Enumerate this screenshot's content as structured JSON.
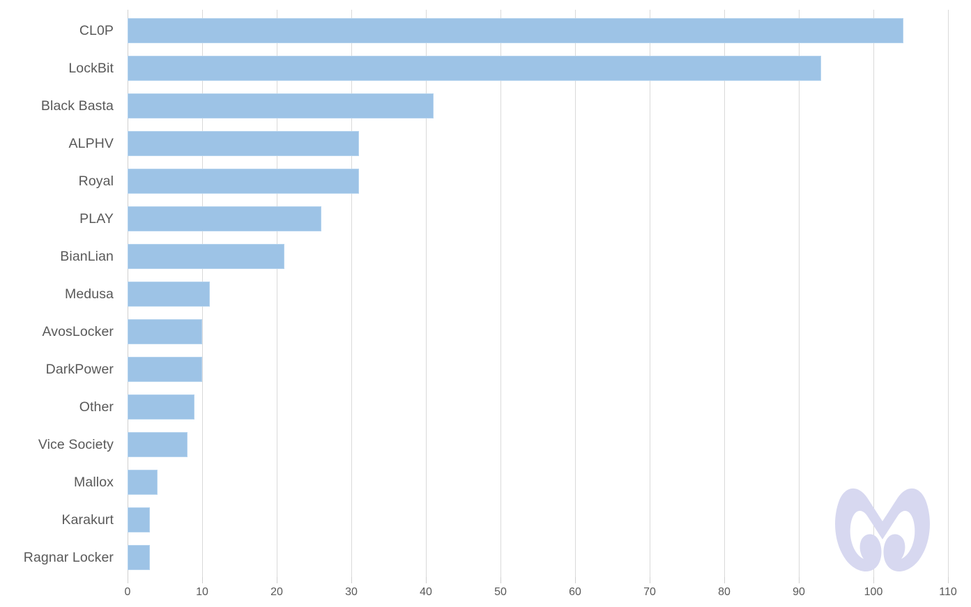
{
  "chart_data": {
    "type": "bar",
    "orientation": "horizontal",
    "title": "",
    "subtitle": "",
    "xlabel": "",
    "ylabel": "",
    "categories": [
      "CL0P",
      "LockBit",
      "Black Basta",
      "ALPHV",
      "Royal",
      "PLAY",
      "BianLian",
      "Medusa",
      "AvosLocker",
      "DarkPower",
      "Other",
      "Vice Society",
      "Mallox",
      "Karakurt",
      "Ragnar Locker"
    ],
    "values": [
      104,
      93,
      41,
      31,
      31,
      26,
      21,
      11,
      10,
      10,
      9,
      8,
      4,
      3,
      3
    ],
    "xlim": [
      0,
      110
    ],
    "xticks": [
      0,
      10,
      20,
      30,
      40,
      50,
      60,
      70,
      80,
      90,
      100,
      110
    ],
    "xtick_labels": [
      "0",
      "10",
      "20",
      "30",
      "40",
      "50",
      "60",
      "70",
      "80",
      "90",
      "100",
      "110"
    ],
    "grid": true,
    "grid_axis": "x",
    "legend": false,
    "legend_position": "none",
    "bar_color": "#9dc3e6",
    "bar_border_color": "#b5d3ee",
    "gridline_color": "#d9d9d9",
    "label_color": "#595959",
    "background_color": "#ffffff"
  },
  "watermark": {
    "name": "malwarebytes-logo",
    "color": "#d7d8f0"
  }
}
